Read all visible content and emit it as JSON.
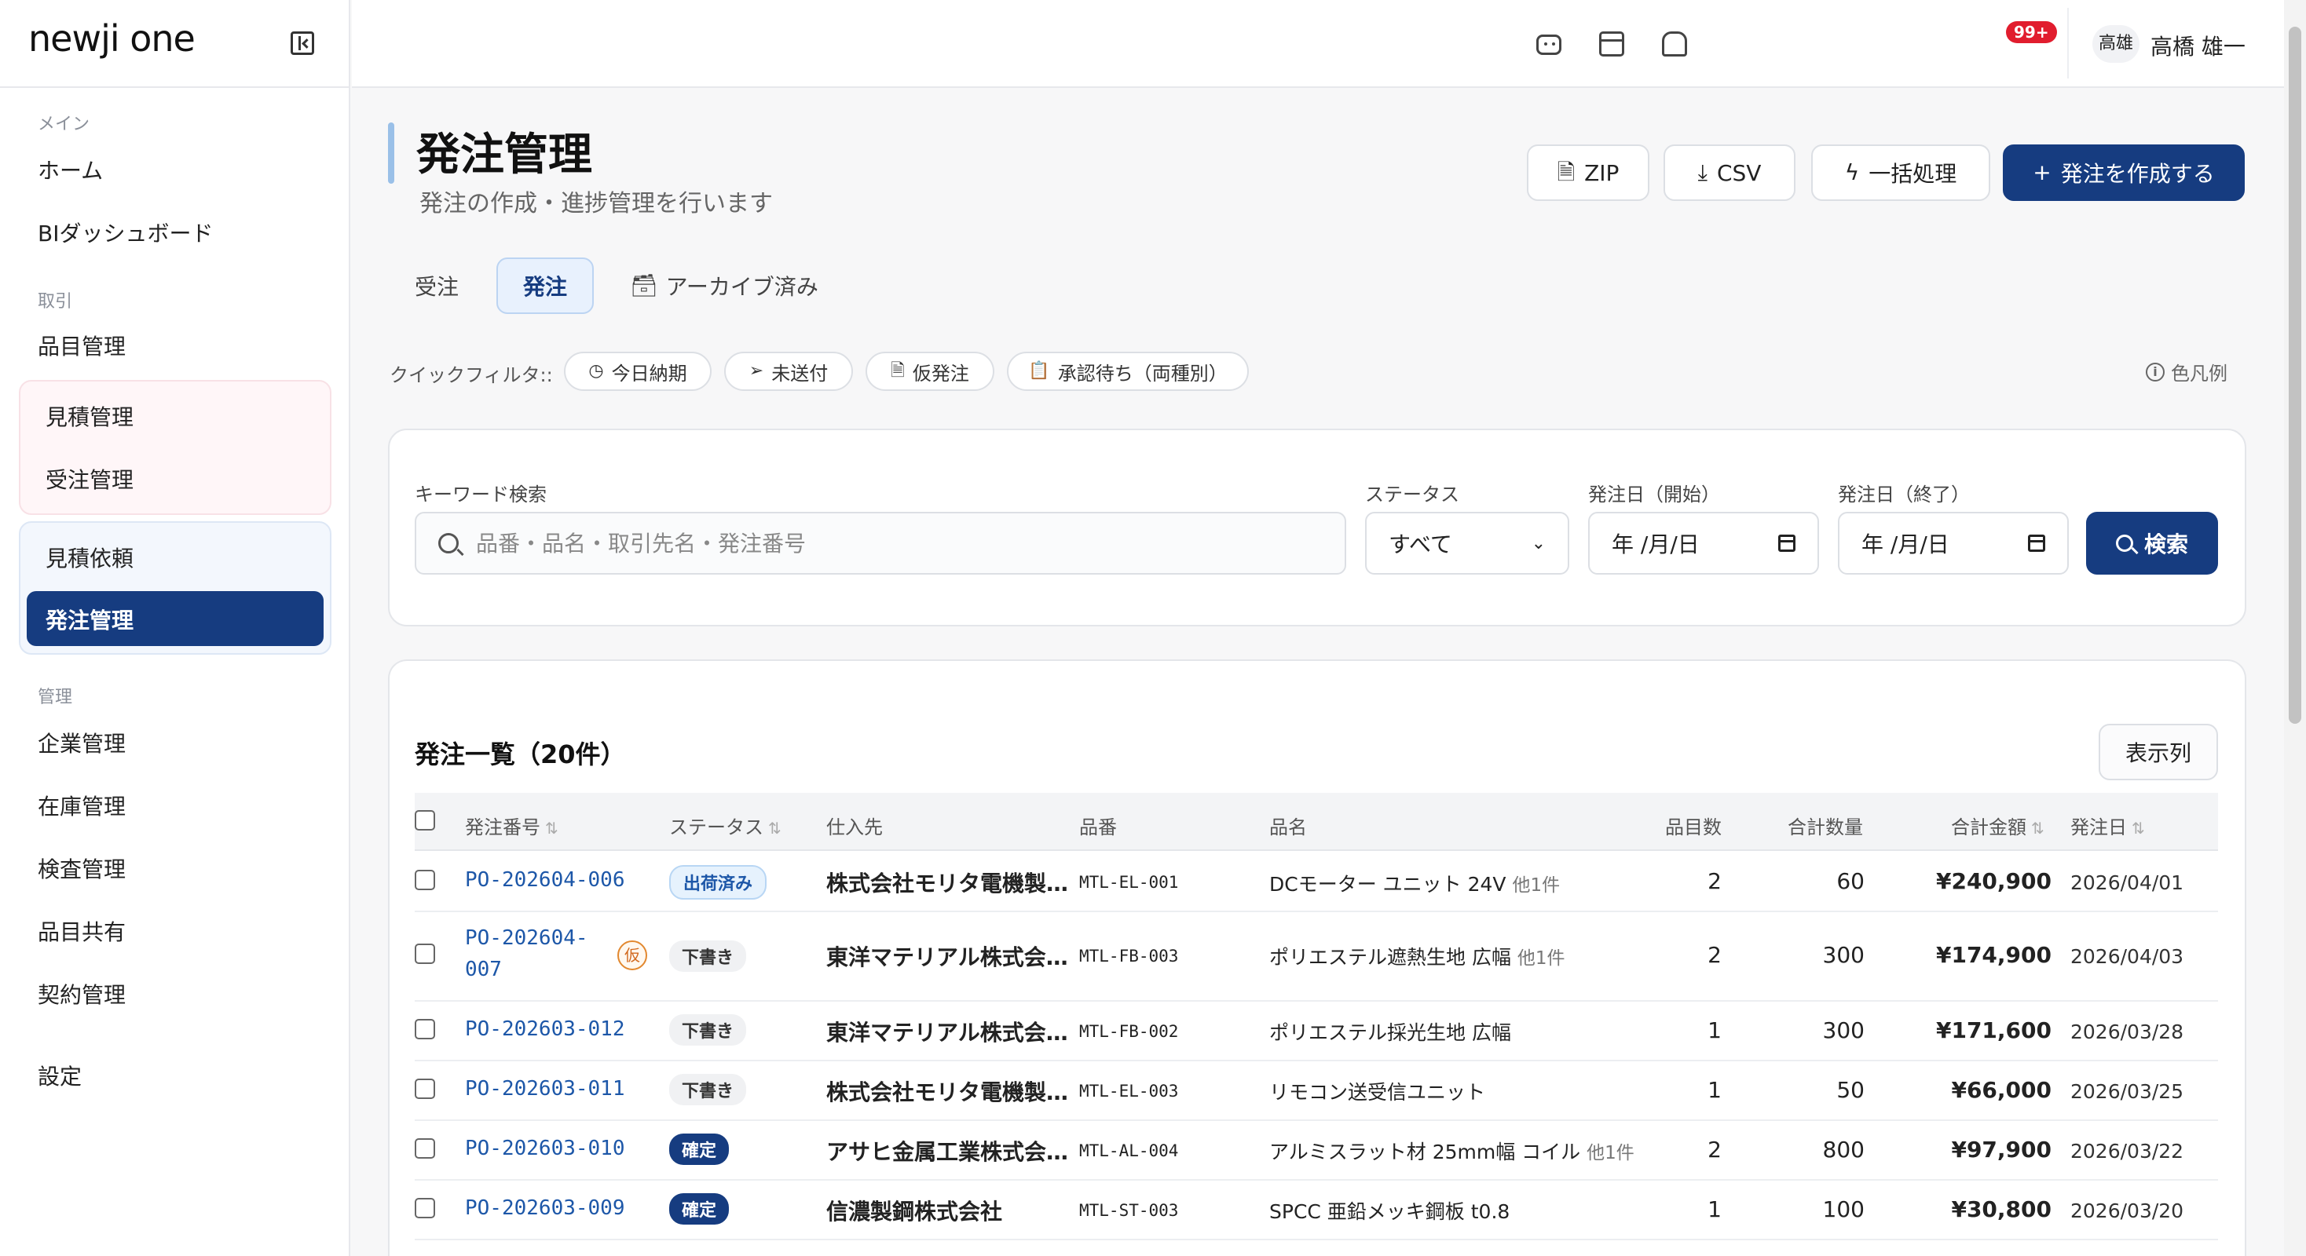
{
  "sidebar": {
    "logo": "newji one",
    "sections": {
      "main": "メイン",
      "trade": "取引",
      "admin": "管理"
    },
    "items": {
      "home": "ホーム",
      "bi": "BIダッシュボード",
      "items": "品目管理",
      "quote": "見積管理",
      "order_received": "受注管理",
      "rfq": "見積依頼",
      "purchase": "発注管理",
      "company": "企業管理",
      "inventory": "在庫管理",
      "inspection": "検査管理",
      "item_share": "品目共有",
      "contract": "契約管理",
      "settings": "設定"
    }
  },
  "topbar": {
    "badge": "99+",
    "avatar": "高雄",
    "user": "高橋 雄一"
  },
  "header": {
    "title": "発注管理",
    "subtitle": "発注の作成・進捗管理を行います",
    "buttons": {
      "zip": "ZIP",
      "csv": "CSV",
      "bulk": "一括処理",
      "create": "発注を作成する"
    }
  },
  "tabs": {
    "received": "受注",
    "purchase": "発注",
    "archived": "アーカイブ済み"
  },
  "quick_filters": {
    "label": "クイックフィルタ::",
    "today": "今日納期",
    "unsent": "未送付",
    "provisional": "仮発注",
    "pending": "承認待ち（両種別）",
    "legend": "色凡例"
  },
  "search": {
    "keyword_label": "キーワード検索",
    "keyword_placeholder": "品番・品名・取引先名・発注番号",
    "status_label": "ステータス",
    "status_value": "すべて",
    "date_start_label": "発注日（開始）",
    "date_end_label": "発注日（終了）",
    "date_placeholder": "年 /月/日",
    "submit": "検索"
  },
  "list": {
    "title": "発注一覧（20件）",
    "columns_button": "表示列",
    "headers": {
      "po": "発注番号",
      "status": "ステータス",
      "supplier": "仕入先",
      "code": "品番",
      "name": "品名",
      "lines": "品目数",
      "qty": "合計数量",
      "amount": "合計金額",
      "date": "発注日"
    },
    "provisional_mark": "仮",
    "rows": [
      {
        "po": "PO-202604-006",
        "status": "出荷済み",
        "supplier": "株式会社モリタ電機製…",
        "code": "MTL-EL-001",
        "name": "DCモーター ユニット 24V",
        "extra": "他1件",
        "lines": "2",
        "qty": "60",
        "amount": "¥240,900",
        "date": "2026/04/01"
      },
      {
        "po_line1": "PO-202604-",
        "po_line2": "007",
        "status": "下書き",
        "supplier": "東洋マテリアル株式会…",
        "code": "MTL-FB-003",
        "name": "ポリエステル遮熱生地 広幅",
        "extra": "他1件",
        "lines": "2",
        "qty": "300",
        "amount": "¥174,900",
        "date": "2026/04/03"
      },
      {
        "po": "PO-202603-012",
        "status": "下書き",
        "supplier": "東洋マテリアル株式会…",
        "code": "MTL-FB-002",
        "name": "ポリエステル採光生地 広幅",
        "lines": "1",
        "qty": "300",
        "amount": "¥171,600",
        "date": "2026/03/28"
      },
      {
        "po": "PO-202603-011",
        "status": "下書き",
        "supplier": "株式会社モリタ電機製…",
        "code": "MTL-EL-003",
        "name": "リモコン送受信ユニット",
        "lines": "1",
        "qty": "50",
        "amount": "¥66,000",
        "date": "2026/03/25"
      },
      {
        "po": "PO-202603-010",
        "status": "確定",
        "supplier": "アサヒ金属工業株式会…",
        "code": "MTL-AL-004",
        "name": "アルミスラット材 25mm幅 コイル",
        "extra": "他1件",
        "lines": "2",
        "qty": "800",
        "amount": "¥97,900",
        "date": "2026/03/22"
      },
      {
        "po": "PO-202603-009",
        "status": "確定",
        "supplier": "信濃製鋼株式会社",
        "code": "MTL-ST-003",
        "name": "SPCC 亜鉛メッキ鋼板 t0.8",
        "lines": "1",
        "qty": "100",
        "amount": "¥30,800",
        "date": "2026/03/20"
      }
    ]
  }
}
